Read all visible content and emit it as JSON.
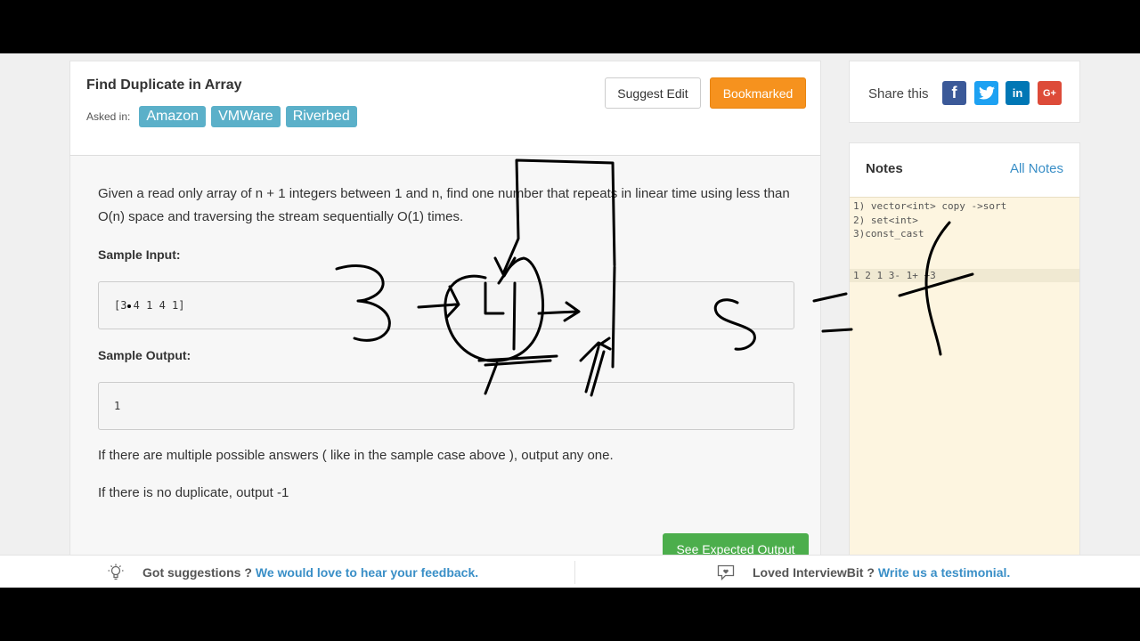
{
  "problem": {
    "title": "Find Duplicate in Array",
    "asked_in_label": "Asked in:",
    "companies": [
      "Amazon",
      "VMWare",
      "Riverbed"
    ],
    "suggest_edit_label": "Suggest Edit",
    "bookmark_label": "Bookmarked",
    "description": "Given a read only array of n + 1 integers between 1 and n, find one number that repeats in linear time using less than O(n) space and traversing the stream sequentially O(1) times.",
    "sample_input_label": "Sample Input:",
    "sample_input": "[3 4 1 4 1]",
    "sample_output_label": "Sample Output:",
    "sample_output": "1",
    "note_multiple": "If there are multiple possible answers ( like in the sample case above ), output any one.",
    "note_none": "If there is no duplicate, output -1",
    "expected_output_label": "See Expected Output"
  },
  "share": {
    "label": "Share this",
    "icons": [
      "facebook-icon",
      "twitter-icon",
      "linkedin-icon",
      "google-plus-icon"
    ]
  },
  "notes": {
    "title": "Notes",
    "all_notes_label": "All Notes",
    "lines": [
      "1) vector<int> copy ->sort",
      "2) set<int>",
      "3)const_cast",
      "",
      "",
      "1 2 1 3- 1+ +3"
    ]
  },
  "footer": {
    "suggestions_text": "Got suggestions ?",
    "suggestions_link": "We would love to hear your feedback.",
    "testimonial_text": "Loved InterviewBit ?",
    "testimonial_link": "Write us a testimonial."
  },
  "colors": {
    "tag": "#5bb0c9",
    "bookmark": "#f6921e",
    "expected_output": "#4cae4c",
    "link": "#3a8fc7",
    "notes_bg": "#fdf5e0"
  }
}
